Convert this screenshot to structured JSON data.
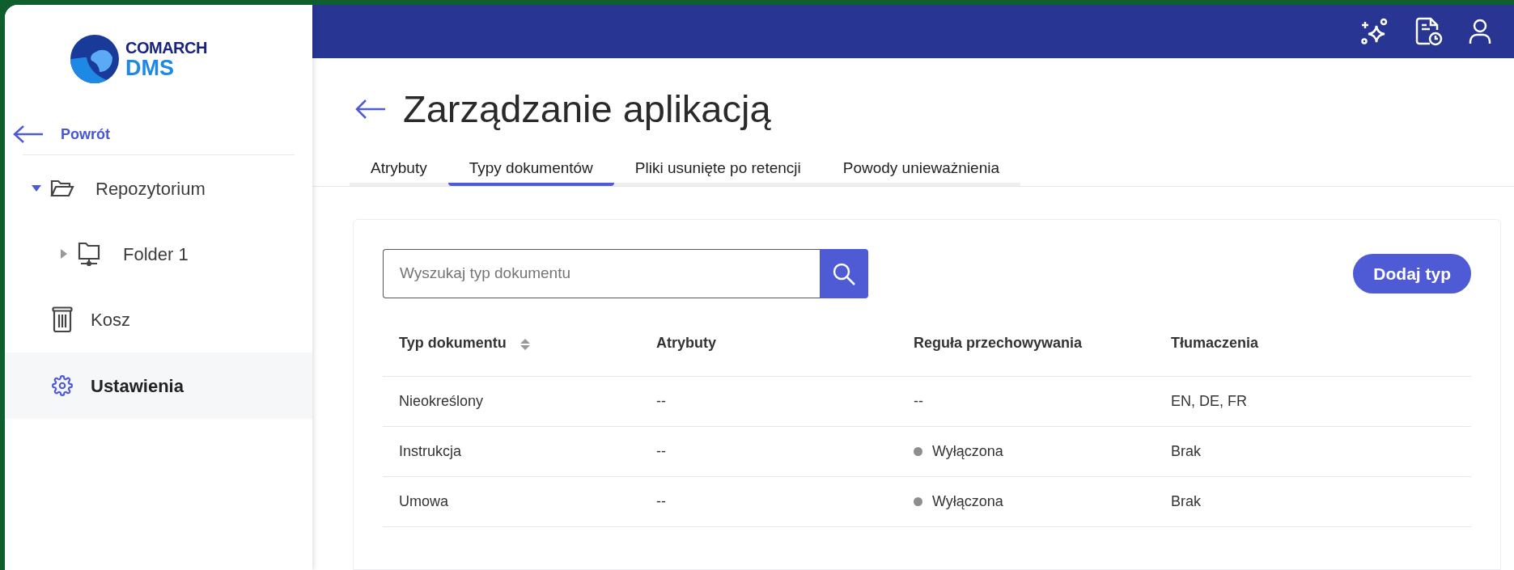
{
  "sidebar": {
    "logo": {
      "brand": "COMARCH",
      "product": "DMS"
    },
    "back_link": "Powrót",
    "tree": [
      {
        "label": "Repozytorium",
        "kind": "folder",
        "expanded": true,
        "children": [
          {
            "label": "Folder 1",
            "kind": "network-folder",
            "expanded": false
          }
        ]
      }
    ],
    "nav": [
      {
        "label": "Kosz",
        "kind": "trash",
        "selected": false
      },
      {
        "label": "Ustawienia",
        "kind": "settings",
        "selected": true
      }
    ]
  },
  "page": {
    "title": "Zarządzanie aplikacją",
    "tabs": [
      {
        "label": "Atrybuty",
        "selected": false
      },
      {
        "label": "Typy dokumentów",
        "selected": true
      },
      {
        "label": "Pliki usunięte po retencji",
        "selected": false
      },
      {
        "label": "Powody unieważnienia",
        "selected": false
      }
    ],
    "search": {
      "placeholder": "Wyszukaj typ dokumentu"
    },
    "add_button": "Dodaj typ",
    "table": {
      "columns": [
        {
          "label": "Typ dokumentu",
          "sortable": true
        },
        {
          "label": "Atrybuty",
          "sortable": false
        },
        {
          "label": "Reguła przechowywania",
          "sortable": false
        },
        {
          "label": "Tłumaczenia",
          "sortable": false
        }
      ],
      "rows": [
        {
          "type": "Nieokreślony",
          "attributes": "--",
          "retention": "--",
          "retention_dot": false,
          "translations": "EN, DE, FR"
        },
        {
          "type": "Instrukcja",
          "attributes": "--",
          "retention": "Wyłączona",
          "retention_dot": true,
          "translations": "Brak"
        },
        {
          "type": "Umowa",
          "attributes": "--",
          "retention": "Wyłączona",
          "retention_dot": true,
          "translations": "Brak"
        }
      ]
    }
  }
}
